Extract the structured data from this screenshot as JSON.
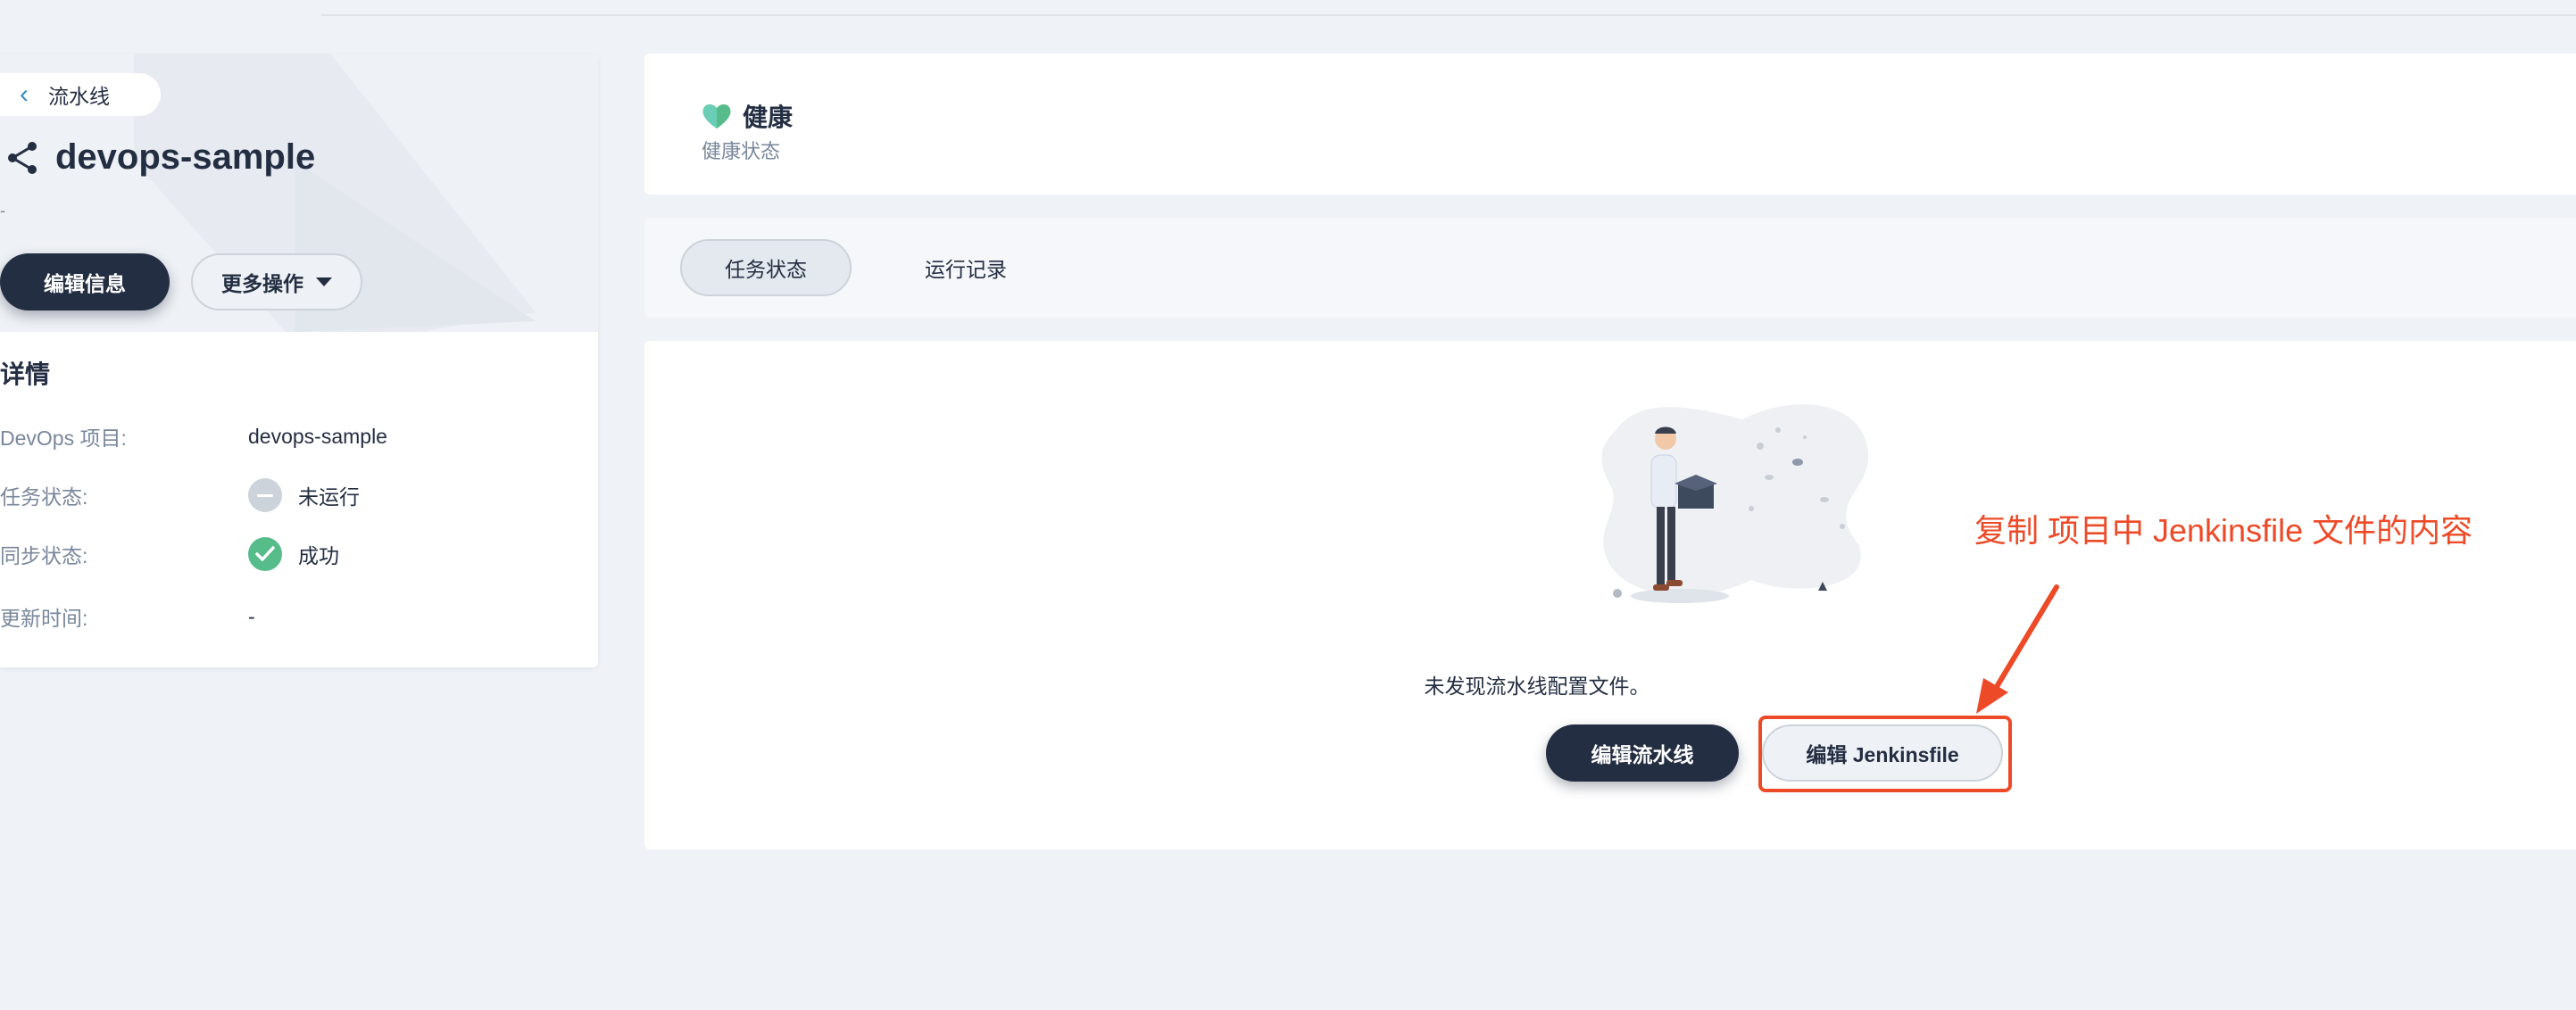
{
  "sidebar": {
    "back_label": "流水线",
    "pipeline_name": "devops-sample",
    "description": "-",
    "edit_info_label": "编辑信息",
    "more_actions_label": "更多操作",
    "details_title": "详情",
    "details": [
      {
        "label": "DevOps 项目:",
        "value": "devops-sample"
      },
      {
        "label": "任务状态:",
        "value": "未运行",
        "status_icon": "not-run-icon"
      },
      {
        "label": "同步状态:",
        "value": "成功",
        "status_icon": "success-check-icon"
      },
      {
        "label": "更新时间:",
        "value": "-"
      }
    ]
  },
  "health": {
    "title": "健康",
    "subtitle": "健康状态",
    "icon": "heart-icon",
    "icon_color": "#55bc8a"
  },
  "tabs": [
    {
      "label": "任务状态",
      "active": true
    },
    {
      "label": "运行记录",
      "active": false
    }
  ],
  "empty_state": {
    "message": "未发现流水线配置文件。",
    "edit_pipeline_label": "编辑流水线",
    "edit_jenkinsfile_label": "编辑 Jenkinsfile"
  },
  "annotation": {
    "text": "复制 项目中 Jenkinsfile 文件的内容",
    "color": "#ed4a27"
  },
  "colors": {
    "primary_dark": "#242e42",
    "background": "#eff2f6",
    "success": "#55bc8a",
    "annotation_red": "#ed4a27"
  }
}
